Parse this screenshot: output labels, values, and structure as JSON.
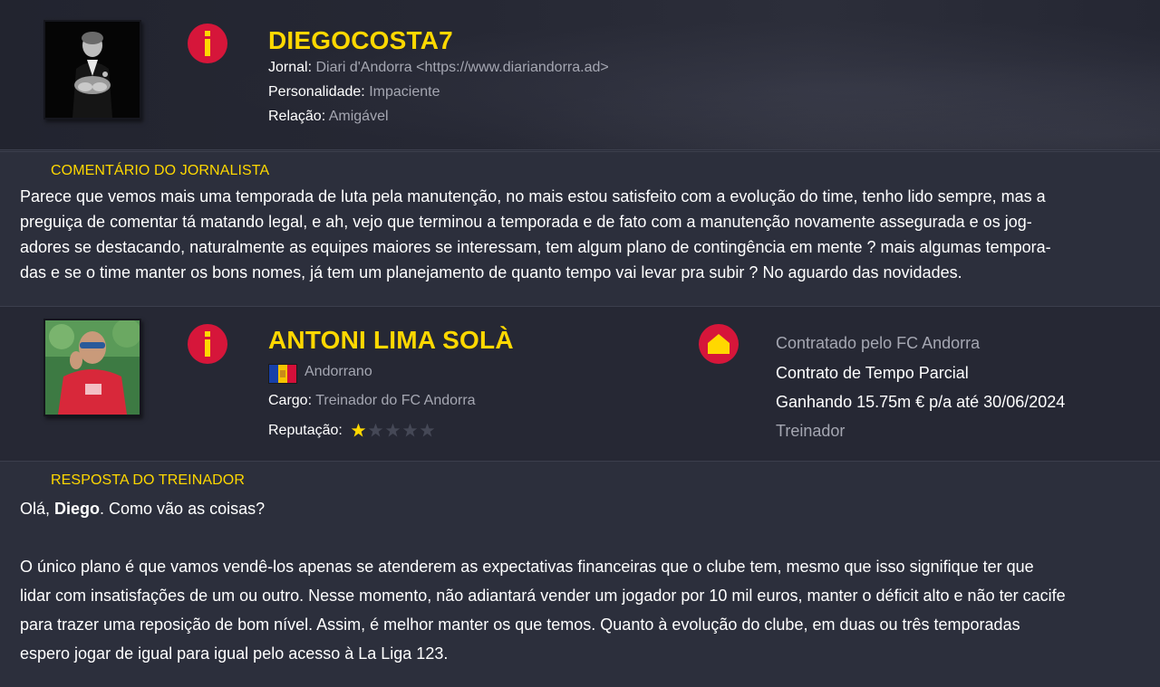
{
  "journalist": {
    "name": "DIEGOCOSTA7",
    "newspaper_label": "Jornal:",
    "newspaper_value": "Diari d'Andorra <https://www.diariandorra.ad>",
    "personality_label": "Personalidade:",
    "personality_value": "Impaciente",
    "relation_label": "Relação:",
    "relation_value": "Amigável"
  },
  "journalist_comment": {
    "heading": "COMENTÁRIO DO JORNALISTA",
    "lines": [
      "Parece que vemos mais uma temporada de luta pela manutenção, no mais estou satisfeito com a evolução do time, tenho lido sempre, mas a",
      "preguiça de comentar tá matando legal, e ah, vejo que terminou a temporada e de fato com a manutenção novamente assegurada e os jog-",
      "adores se destacando, naturalmente as equipes maiores se interessam, tem algum plano de contingência em mente ? mais algumas tempora-",
      "das e se o time manter os bons nomes, já tem um planejamento de quanto tempo vai levar pra subir ? No aguardo das novidades."
    ]
  },
  "coach": {
    "name": "ANTONI LIMA SOLÀ",
    "nationality": "Andorrano",
    "role_label": "Cargo:",
    "role_value": "Treinador do FC Andorra",
    "reputation_label": "Reputação:",
    "reputation_stars": 1,
    "reputation_max": 5,
    "flag_colors": [
      "#1740a8",
      "#f5c400",
      "#d4103a"
    ]
  },
  "contract": {
    "hired_by": "Contratado pelo FC Andorra",
    "type": "Contrato de Tempo Parcial",
    "salary": "Ganhando 15.75m € p/a até 30/06/2024",
    "position": "Treinador"
  },
  "coach_reply": {
    "heading": "RESPOSTA DO TREINADOR",
    "greeting_pre": "Olá, ",
    "greeting_name": "Diego",
    "greeting_post": ". Como vão as coisas?",
    "lines": [
      "O único plano é que vamos vendê-los apenas se atenderem as expectativas financeiras que o clube tem, mesmo que isso signifique ter que",
      "lidar com insatisfações de um ou outro. Nesse momento, não adiantará vender um jogador por 10 mil euros, manter o déficit alto e não ter cacife",
      "para trazer uma reposição de bom nível. Assim, é melhor manter os que temos.  Quanto à evolução do clube, em duas ou três temporadas",
      "espero jogar de igual para igual pelo acesso à La Liga 123."
    ]
  },
  "colors": {
    "accent_yellow": "#ffd800",
    "icon_red": "#d6163a",
    "background": "#2a2d3a"
  },
  "icons": {
    "journalist_info": "info-icon",
    "coach_info": "info-icon",
    "contract": "home-icon",
    "star": "star-icon"
  }
}
